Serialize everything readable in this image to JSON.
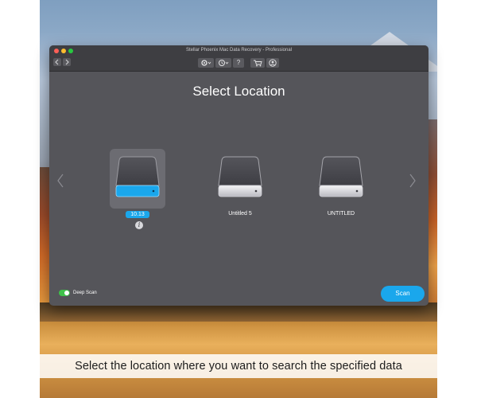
{
  "window": {
    "title": "Stellar Phoenix Mac Data Recovery - Professional",
    "nav": {
      "back_icon": "chevron-left",
      "forward_icon": "chevron-right"
    },
    "toolbar": {
      "settings_icon": "gear-icon",
      "history_icon": "clock-icon",
      "help_label": "?",
      "cart_icon": "cart-icon",
      "account_icon": "user-icon"
    }
  },
  "main": {
    "heading": "Select Location",
    "drives": [
      {
        "label": "10.13",
        "selected": true
      },
      {
        "label": "Untitled 5",
        "selected": false
      },
      {
        "label": "UNTITLED",
        "selected": false
      }
    ],
    "info_label": "i",
    "deep_scan": {
      "label": "Deep Scan",
      "enabled": true
    },
    "scan_button": "Scan"
  },
  "caption": "Select the location where you want to search the specified data",
  "colors": {
    "accent": "#1aa7ec",
    "toggle_on": "#3ec24a",
    "window_bg": "#55555a",
    "titlebar_bg": "#3e3e42"
  }
}
